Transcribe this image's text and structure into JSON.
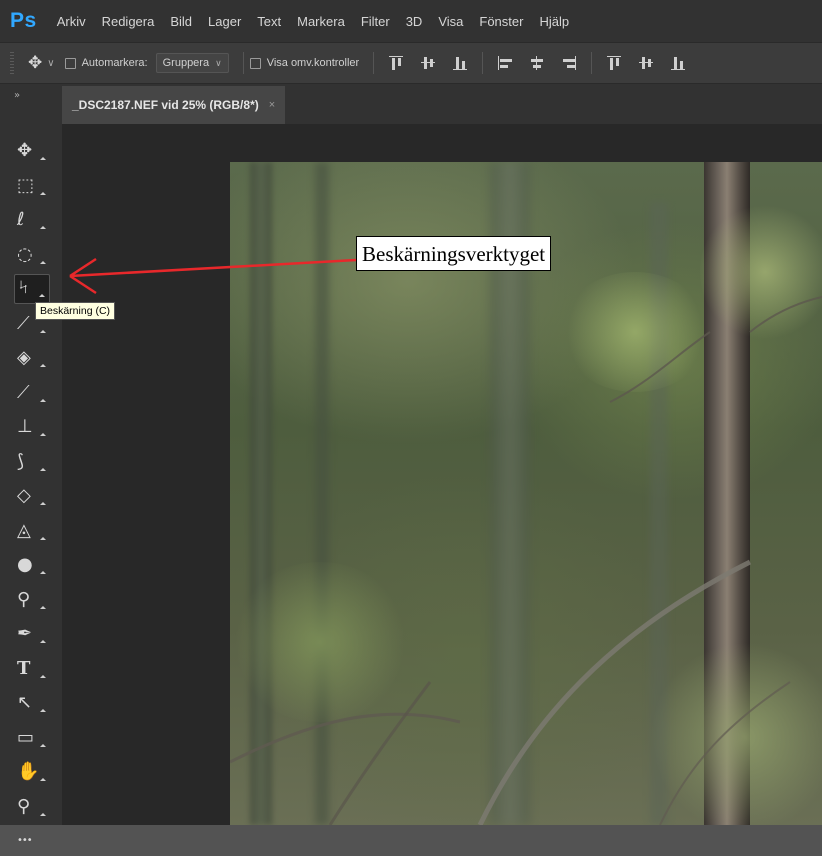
{
  "app": {
    "logo": "Ps",
    "accent_color": "#31a8ff"
  },
  "menu": [
    "Arkiv",
    "Redigera",
    "Bild",
    "Lager",
    "Text",
    "Markera",
    "Filter",
    "3D",
    "Visa",
    "Fönster",
    "Hjälp"
  ],
  "options_bar": {
    "tool_icon": "move-icon",
    "auto_select_label": "Automarkera:",
    "auto_select_checked": false,
    "auto_select_value": "Gruppera",
    "transform_controls_label": "Visa omv.kontroller",
    "transform_controls_checked": false,
    "align_icons": [
      "align-top-icon",
      "align-vcenter-icon",
      "align-bottom-icon",
      "align-left-icon",
      "align-hcenter-icon",
      "align-right-icon",
      "distribute-top-icon",
      "distribute-vcenter-icon",
      "distribute-bottom-icon"
    ]
  },
  "document_tab": {
    "title": "_DSC2187.NEF vid 25% (RGB/8*)",
    "close_glyph": "×"
  },
  "tools": [
    {
      "name": "move-tool",
      "icon": "move-icon"
    },
    {
      "name": "marquee-tool",
      "icon": "rectangular-marquee-icon"
    },
    {
      "name": "lasso-tool",
      "icon": "lasso-icon"
    },
    {
      "name": "quick-selection-tool",
      "icon": "quick-selection-icon"
    },
    {
      "name": "crop-tool",
      "icon": "crop-icon",
      "selected": true
    },
    {
      "name": "eyedropper-tool",
      "icon": "eyedropper-icon"
    },
    {
      "name": "healing-brush-tool",
      "icon": "bandage-icon"
    },
    {
      "name": "brush-tool",
      "icon": "brush-icon"
    },
    {
      "name": "clone-stamp-tool",
      "icon": "stamp-icon"
    },
    {
      "name": "history-brush-tool",
      "icon": "history-brush-icon"
    },
    {
      "name": "eraser-tool",
      "icon": "eraser-icon"
    },
    {
      "name": "paint-bucket-tool",
      "icon": "paint-bucket-icon"
    },
    {
      "name": "blur-tool",
      "icon": "drop-icon"
    },
    {
      "name": "dodge-tool",
      "icon": "dodge-icon"
    },
    {
      "name": "pen-tool",
      "icon": "pen-icon"
    },
    {
      "name": "type-tool",
      "icon": "type-icon"
    },
    {
      "name": "path-selection-tool",
      "icon": "arrow-cursor-icon"
    },
    {
      "name": "rectangle-tool",
      "icon": "rectangle-icon"
    },
    {
      "name": "hand-tool",
      "icon": "hand-icon"
    },
    {
      "name": "zoom-tool",
      "icon": "magnifier-icon"
    },
    {
      "name": "more-tools",
      "icon": "ellipsis-icon"
    }
  ],
  "tooltip": {
    "text": "Beskärning (C)"
  },
  "annotation": {
    "text": "Beskärningsverktyget",
    "arrow_color": "#e8282b"
  }
}
